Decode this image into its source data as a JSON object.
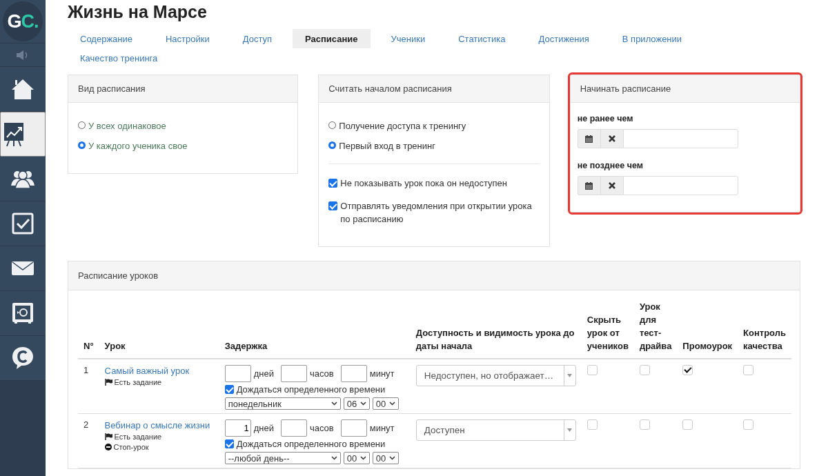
{
  "sidebar": {
    "logo": {
      "main": "G",
      "accent": "C."
    },
    "items": [
      {
        "kind": "sound",
        "selected": false
      },
      {
        "kind": "home",
        "selected": false
      },
      {
        "kind": "chart",
        "selected": true
      },
      {
        "kind": "users",
        "selected": false
      },
      {
        "kind": "tasks",
        "selected": false
      },
      {
        "kind": "mail",
        "selected": false
      },
      {
        "kind": "safe",
        "selected": false
      },
      {
        "kind": "chat",
        "selected": false
      }
    ]
  },
  "page": {
    "title": "Жизнь на Марсе"
  },
  "tabs": [
    {
      "label": "Содержание",
      "selected": false
    },
    {
      "label": "Настройки",
      "selected": false
    },
    {
      "label": "Доступ",
      "selected": false
    },
    {
      "label": "Расписание",
      "selected": true
    },
    {
      "label": "Ученики",
      "selected": false
    },
    {
      "label": "Статистика",
      "selected": false
    },
    {
      "label": "Достижения",
      "selected": false
    },
    {
      "label": "В приложении",
      "selected": false
    },
    {
      "label": "Качество тренинга",
      "selected": false
    }
  ],
  "schedule_type": {
    "title": "Вид расписания",
    "options": [
      {
        "label": "У всех одинаковое",
        "selected": false
      },
      {
        "label": "У каждого ученика свое",
        "selected": true
      }
    ]
  },
  "schedule_start": {
    "title": "Считать началом расписания",
    "options": [
      {
        "label": "Получение доступа к тренингу",
        "selected": false
      },
      {
        "label": "Первый вход в тренинг",
        "selected": true
      }
    ],
    "checkboxes": [
      {
        "label": "Не показывать урок пока он недоступен",
        "checked": true
      },
      {
        "label": "Отправлять уведомления при открытии урока по расписанию",
        "checked": true
      }
    ]
  },
  "start_limits": {
    "title": "Начинать расписание",
    "highlighted": true,
    "fields": [
      {
        "label": "не ранее чем"
      },
      {
        "label": "не позднее чем"
      }
    ]
  },
  "lessons": {
    "title": "Расписание уроков",
    "columns": [
      "N°",
      "Урок",
      "Задержка",
      "Доступность и видимость урока до даты начала",
      "Скрыть урок от учеников",
      "Урок для тест-драйва",
      "Промоурок",
      "Контроль качества"
    ],
    "rows": [
      {
        "number": "1",
        "title": "Самый важный урок",
        "tags": [
          {
            "kind": "task",
            "label": "Есть задание"
          }
        ],
        "delay": [
          {
            "unit": "дней"
          },
          {
            "unit": "часов"
          },
          {
            "unit": "минут"
          }
        ],
        "wait": {
          "label": "Дождаться определенного времени",
          "checked": true
        },
        "day": "понедельник",
        "hour": "06",
        "minute": "00",
        "availability": "Недоступен, но отображает…",
        "hidden": false,
        "test_drive": false,
        "promo": true,
        "quality": false
      },
      {
        "number": "2",
        "title": "Вебинар о смысле жизни",
        "tags": [
          {
            "kind": "task",
            "label": "Есть задание"
          },
          {
            "kind": "stop",
            "label": "Стоп-урок"
          }
        ],
        "delay": [
          {
            "unit": "дней",
            "value": "1"
          },
          {
            "unit": "часов"
          },
          {
            "unit": "минут"
          }
        ],
        "wait": {
          "label": "Дождаться определенного времени",
          "checked": true
        },
        "day": "--любой день--",
        "hour": "00",
        "minute": "00",
        "availability": "Доступен",
        "hidden": false,
        "test_drive": false,
        "promo": false,
        "quality": false
      }
    ]
  }
}
